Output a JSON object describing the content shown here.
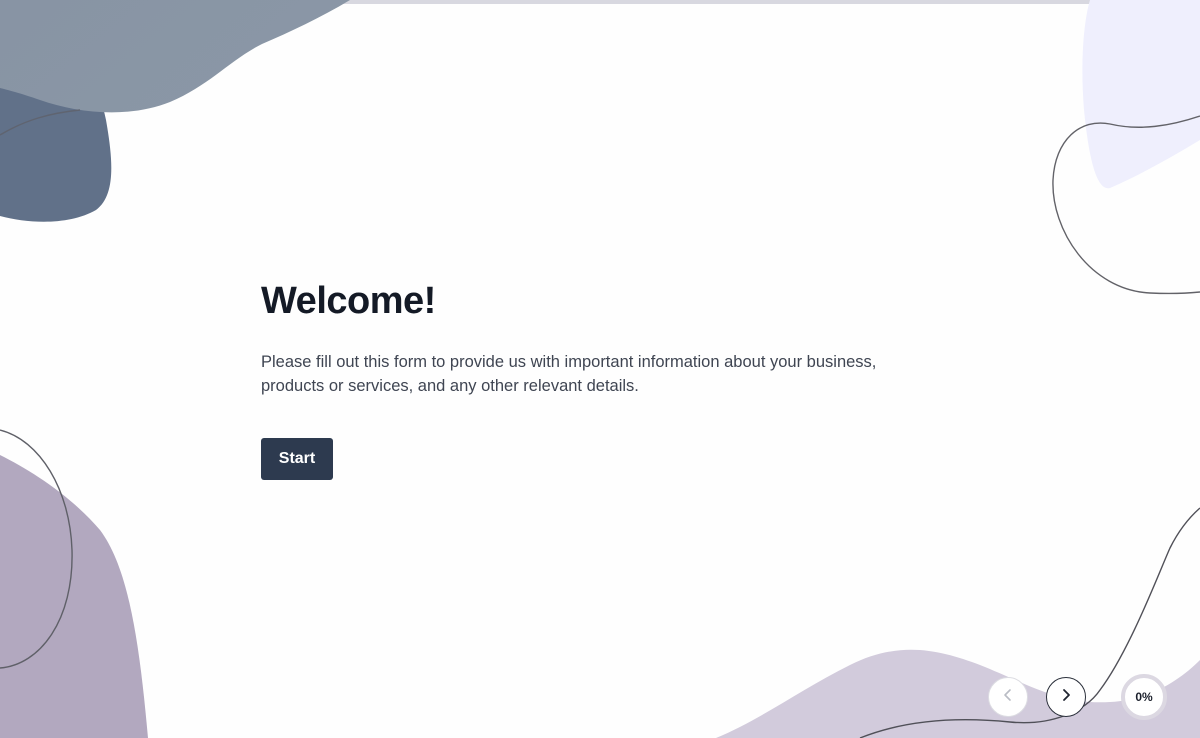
{
  "welcome": {
    "title": "Welcome!",
    "description": "Please fill out this form to provide us with important information about your business, products or services, and any other relevant details.",
    "start_label": "Start"
  },
  "navigation": {
    "prev_icon": "chevron-left-icon",
    "next_icon": "chevron-right-icon"
  },
  "progress": {
    "label": "0%",
    "value": 0
  },
  "colors": {
    "primary_button": "#2d3a4f",
    "title": "#141a26",
    "blob_slate": "#6b7a8f",
    "blob_mauve": "#b2a6bd",
    "blob_lavender": "#efeefe"
  }
}
